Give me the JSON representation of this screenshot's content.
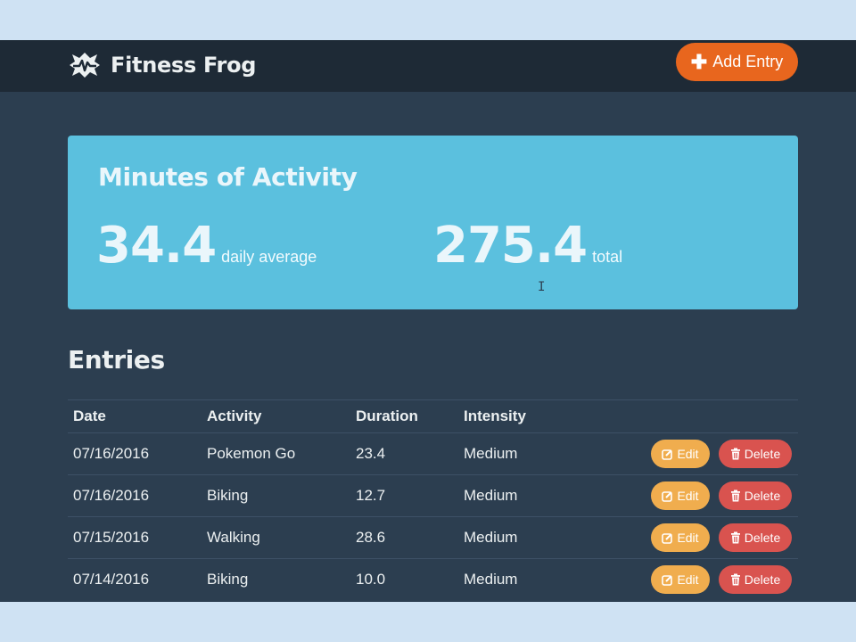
{
  "navbar": {
    "brand": "Fitness Frog",
    "brand_icon": "frog-logo-icon",
    "add_entry_label": "Add Entry",
    "add_entry_icon": "plus-icon"
  },
  "summary": {
    "title": "Minutes of Activity",
    "average_value": "34.4",
    "average_label": "daily average",
    "total_value": "275.4",
    "total_label": "total"
  },
  "entries": {
    "title": "Entries",
    "columns": [
      "Date",
      "Activity",
      "Duration",
      "Intensity"
    ],
    "rows": [
      {
        "date": "07/16/2016",
        "activity": "Pokemon Go",
        "duration": "23.4",
        "intensity": "Medium"
      },
      {
        "date": "07/16/2016",
        "activity": "Biking",
        "duration": "12.7",
        "intensity": "Medium"
      },
      {
        "date": "07/15/2016",
        "activity": "Walking",
        "duration": "28.6",
        "intensity": "Medium"
      },
      {
        "date": "07/14/2016",
        "activity": "Biking",
        "duration": "10.0",
        "intensity": "Medium"
      }
    ],
    "edit_label": "Edit",
    "delete_label": "Delete",
    "edit_icon": "edit-icon",
    "delete_icon": "trash-icon"
  },
  "colors": {
    "navbar": "#1e2a36",
    "background": "#2c3e50",
    "summary_panel": "#5bc0de",
    "add_button": "#e8661e",
    "edit_button": "#f0ad4e",
    "delete_button": "#d9534f"
  }
}
